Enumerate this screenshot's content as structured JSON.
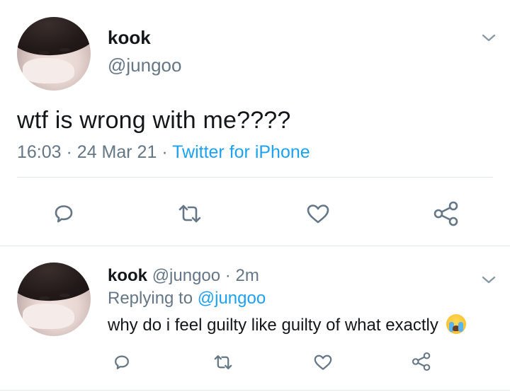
{
  "main_tweet": {
    "author_name": "kook",
    "author_handle": "@jungoo",
    "text": "wtf is wrong with me????",
    "time": "16:03",
    "separator": "·",
    "date": "24 Mar 21",
    "source": "Twitter for iPhone"
  },
  "reply_tweet": {
    "author_name": "kook",
    "author_handle": "@jungoo",
    "separator": "·",
    "time_ago": "2m",
    "replying_prefix": "Replying to",
    "replying_to": "@jungoo",
    "text": "why do i feel guilty like guilty of what exactly",
    "emoji_icon": "loudly-crying-face-emoji"
  },
  "colors": {
    "text": "#14171a",
    "secondary": "#657786",
    "accent": "#1da1f2",
    "divider": "#e1e8ed",
    "icon": "#657786"
  },
  "actions": [
    "reply-icon",
    "retweet-icon",
    "like-icon",
    "share-icon"
  ]
}
